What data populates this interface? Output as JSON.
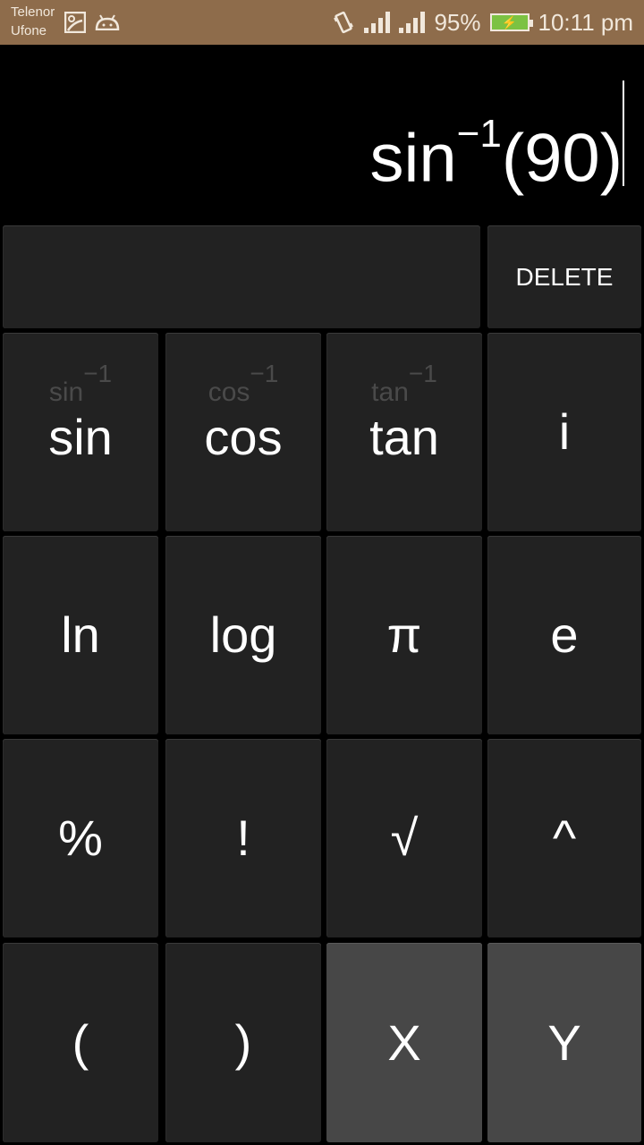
{
  "status_bar": {
    "carriers": [
      "Telenor",
      "Ufone"
    ],
    "left_icons": [
      "image-icon",
      "android-debug-icon"
    ],
    "right_icons": [
      "vibrate-icon",
      "signal-icon",
      "signal-icon"
    ],
    "battery_percent": "95%",
    "battery_level": 0.95,
    "battery_charging": true,
    "time": "10:11 pm"
  },
  "display": {
    "expression_fn": "sin",
    "expression_exp": "−1",
    "expression_arg": "(90)"
  },
  "top_row": {
    "delete_label": "DELETE"
  },
  "keys": [
    {
      "label": "sin",
      "inverse": "sin",
      "inverse_exp": "−1"
    },
    {
      "label": "cos",
      "inverse": "cos",
      "inverse_exp": "−1"
    },
    {
      "label": "tan",
      "inverse": "tan",
      "inverse_exp": "−1"
    },
    {
      "label": "i"
    },
    {
      "label": "ln"
    },
    {
      "label": "log"
    },
    {
      "label": "π"
    },
    {
      "label": "e"
    },
    {
      "label": "%"
    },
    {
      "label": "!"
    },
    {
      "label": "√"
    },
    {
      "label": "^"
    },
    {
      "label": "("
    },
    {
      "label": ")"
    },
    {
      "label": "X"
    },
    {
      "label": "Y"
    }
  ],
  "colors": {
    "status_bar": "#8e6c4b",
    "key": "#222222",
    "key_variable": "#474747",
    "battery": "#7cc242"
  }
}
